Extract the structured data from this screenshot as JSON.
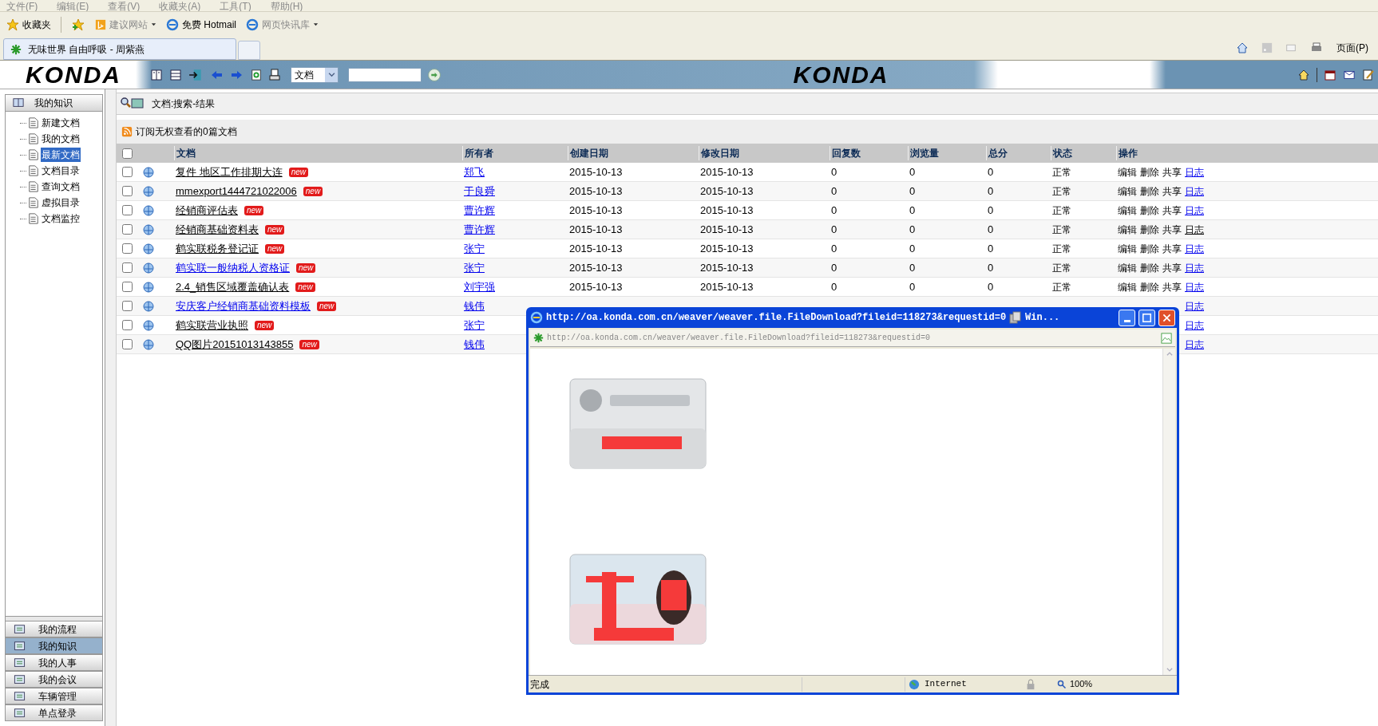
{
  "browser": {
    "menu": [
      {
        "label": "文件(F)"
      },
      {
        "label": "编辑(E)"
      },
      {
        "label": "查看(V)"
      },
      {
        "label": "收藏夹(A)"
      },
      {
        "label": "工具(T)"
      },
      {
        "label": "帮助(H)"
      }
    ],
    "favorites": [
      {
        "label": "收藏夹",
        "kind": "star",
        "disabled": false
      },
      {
        "label": "建议网站",
        "kind": "bing",
        "disabled": true
      },
      {
        "label": "免费 Hotmail",
        "kind": "ie",
        "disabled": false
      },
      {
        "label": "网页快讯库",
        "kind": "ie",
        "disabled": true
      }
    ],
    "tab": {
      "title": "无味世界 自由呼吸 - 周紫燕"
    },
    "page_menu": "页面(P)"
  },
  "header": {
    "logo_left": "KONDA",
    "logo_right": "KONDA",
    "search_scope": "文档"
  },
  "sidebar": {
    "title": "我的知识",
    "items": [
      {
        "label": "新建文档",
        "selected": false
      },
      {
        "label": "我的文档",
        "selected": false
      },
      {
        "label": "最新文档",
        "selected": true
      },
      {
        "label": "文档目录",
        "selected": false
      },
      {
        "label": "查询文档",
        "selected": false
      },
      {
        "label": "虚拟目录",
        "selected": false
      },
      {
        "label": "文档监控",
        "selected": false
      }
    ],
    "nav": [
      {
        "label": "我的流程",
        "selected": false
      },
      {
        "label": "我的知识",
        "selected": true
      },
      {
        "label": "我的人事",
        "selected": false
      },
      {
        "label": "我的会议",
        "selected": false
      },
      {
        "label": "车辆管理",
        "selected": false
      },
      {
        "label": "单点登录",
        "selected": false
      }
    ]
  },
  "breadcrumb": "文档:搜索-结果",
  "subscribe_note": "订阅无权查看的0篇文档",
  "table": {
    "columns": [
      "文档",
      "所有者",
      "创建日期",
      "修改日期",
      "回复数",
      "浏览量",
      "总分",
      "状态",
      "操作"
    ],
    "all_checked": false,
    "rows": [
      {
        "checked": false,
        "doc": "复件  地区工作排期大连",
        "visited": true,
        "badge": "new",
        "owner": "郑飞",
        "created": "2015-10-13",
        "modified": "2015-10-13",
        "replies": "0",
        "views": "0",
        "score": "0",
        "status": "正常",
        "actions": [
          {
            "label": "编辑",
            "kind": "text"
          },
          {
            "label": "删除",
            "kind": "text"
          },
          {
            "label": "共享",
            "kind": "text"
          },
          {
            "label": "日志",
            "kind": "link",
            "visited": false
          }
        ]
      },
      {
        "checked": false,
        "doc": "mmexport1444721022006",
        "visited": true,
        "badge": "new",
        "owner": "于良舜",
        "created": "2015-10-13",
        "modified": "2015-10-13",
        "replies": "0",
        "views": "0",
        "score": "0",
        "status": "正常",
        "actions": [
          {
            "label": "编辑",
            "kind": "text"
          },
          {
            "label": "删除",
            "kind": "text"
          },
          {
            "label": "共享",
            "kind": "text"
          },
          {
            "label": "日志",
            "kind": "link",
            "visited": false
          }
        ]
      },
      {
        "checked": false,
        "doc": "经销商评估表",
        "visited": true,
        "badge": "new",
        "owner": "曹许辉",
        "created": "2015-10-13",
        "modified": "2015-10-13",
        "replies": "0",
        "views": "0",
        "score": "0",
        "status": "正常",
        "actions": [
          {
            "label": "编辑",
            "kind": "text"
          },
          {
            "label": "删除",
            "kind": "text"
          },
          {
            "label": "共享",
            "kind": "text"
          },
          {
            "label": "日志",
            "kind": "link",
            "visited": false
          }
        ]
      },
      {
        "checked": false,
        "doc": "经销商基础资料表",
        "visited": true,
        "badge": "new",
        "owner": "曹许辉",
        "created": "2015-10-13",
        "modified": "2015-10-13",
        "replies": "0",
        "views": "0",
        "score": "0",
        "status": "正常",
        "actions": [
          {
            "label": "编辑",
            "kind": "text"
          },
          {
            "label": "删除",
            "kind": "text"
          },
          {
            "label": "共享",
            "kind": "text"
          },
          {
            "label": "日志",
            "kind": "link",
            "visited": true
          }
        ]
      },
      {
        "checked": false,
        "doc": "鹤实联税务登记证",
        "visited": true,
        "badge": "new",
        "owner": "张宁",
        "created": "2015-10-13",
        "modified": "2015-10-13",
        "replies": "0",
        "views": "0",
        "score": "0",
        "status": "正常",
        "actions": [
          {
            "label": "编辑",
            "kind": "text"
          },
          {
            "label": "删除",
            "kind": "text"
          },
          {
            "label": "共享",
            "kind": "text"
          },
          {
            "label": "日志",
            "kind": "link",
            "visited": false
          }
        ]
      },
      {
        "checked": false,
        "doc": "鹤实联一般纳税人资格证",
        "visited": false,
        "badge": "new",
        "owner": "张宁",
        "created": "2015-10-13",
        "modified": "2015-10-13",
        "replies": "0",
        "views": "0",
        "score": "0",
        "status": "正常",
        "actions": [
          {
            "label": "编辑",
            "kind": "text"
          },
          {
            "label": "删除",
            "kind": "text"
          },
          {
            "label": "共享",
            "kind": "text"
          },
          {
            "label": "日志",
            "kind": "link",
            "visited": false
          }
        ]
      },
      {
        "checked": false,
        "doc": "2.4_销售区域覆盖确认表",
        "visited": true,
        "badge": "new",
        "owner": "刘宇强",
        "created": "2015-10-13",
        "modified": "2015-10-13",
        "replies": "0",
        "views": "0",
        "score": "0",
        "status": "正常",
        "actions": [
          {
            "label": "编辑",
            "kind": "text"
          },
          {
            "label": "删除",
            "kind": "text"
          },
          {
            "label": "共享",
            "kind": "text"
          },
          {
            "label": "日志",
            "kind": "link",
            "visited": false
          }
        ]
      },
      {
        "checked": false,
        "doc": "安庆客户经销商基础资料模板",
        "visited": false,
        "badge": "new",
        "owner": "钱伟",
        "actions": [
          {
            "label": "日志",
            "kind": "link",
            "visited": false
          }
        ]
      },
      {
        "checked": false,
        "doc": "鹤实联营业执照",
        "visited": true,
        "badge": "new",
        "owner": "张宁",
        "actions": [
          {
            "label": "日志",
            "kind": "link",
            "visited": false
          }
        ]
      },
      {
        "checked": false,
        "doc": "QQ图片20151013143855",
        "visited": true,
        "badge": "new",
        "owner": "钱伟",
        "actions": [
          {
            "label": "日志",
            "kind": "link",
            "visited": false
          }
        ]
      }
    ]
  },
  "popup": {
    "title": "http://oa.konda.com.cn/weaver/weaver.file.FileDownload?fileid=118273&requestid=0",
    "title_tail": "Win...",
    "address": "http://oa.konda.com.cn/weaver/weaver.file.FileDownload?fileid=118273&requestid=0",
    "status": "完成",
    "zone": "Internet",
    "zoom": "100%"
  }
}
